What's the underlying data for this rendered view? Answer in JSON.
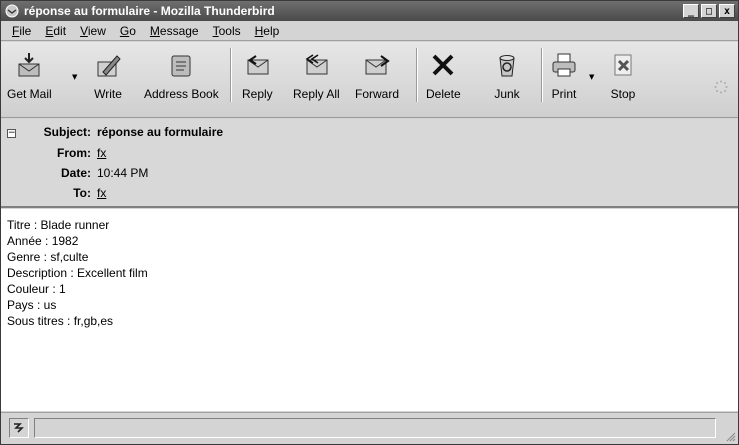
{
  "window": {
    "title": "réponse au formulaire - Mozilla Thunderbird",
    "controls": {
      "minimize": "_",
      "maximize": "□",
      "close": "x"
    }
  },
  "menubar": {
    "items": [
      {
        "label": "File",
        "accel": "F"
      },
      {
        "label": "Edit",
        "accel": "E"
      },
      {
        "label": "View",
        "accel": "V"
      },
      {
        "label": "Go",
        "accel": "G"
      },
      {
        "label": "Message",
        "accel": "M"
      },
      {
        "label": "Tools",
        "accel": "T"
      },
      {
        "label": "Help",
        "accel": "H"
      }
    ]
  },
  "toolbar": {
    "buttons": [
      {
        "label": "Get Mail",
        "icon": "get-mail-icon"
      },
      {
        "label": "Write",
        "icon": "write-icon"
      },
      {
        "label": "Address Book",
        "icon": "address-book-icon"
      },
      {
        "label": "Reply",
        "icon": "reply-icon"
      },
      {
        "label": "Reply All",
        "icon": "reply-all-icon"
      },
      {
        "label": "Forward",
        "icon": "forward-icon"
      },
      {
        "label": "Delete",
        "icon": "delete-icon"
      },
      {
        "label": "Junk",
        "icon": "junk-icon"
      },
      {
        "label": "Print",
        "icon": "print-icon"
      },
      {
        "label": "Stop",
        "icon": "stop-icon"
      }
    ]
  },
  "headers": {
    "subject_label": "Subject:",
    "subject": "réponse au formulaire",
    "from_label": "From:",
    "from": "fx",
    "date_label": "Date:",
    "date": "10:44 PM",
    "to_label": "To:",
    "to": "fx"
  },
  "body": {
    "lines": [
      "Titre : Blade runner",
      "Année : 1982",
      "Genre : sf,culte",
      "Description : Excellent film",
      "Couleur : 1",
      "Pays : us",
      "Sous titres : fr,gb,es"
    ]
  }
}
